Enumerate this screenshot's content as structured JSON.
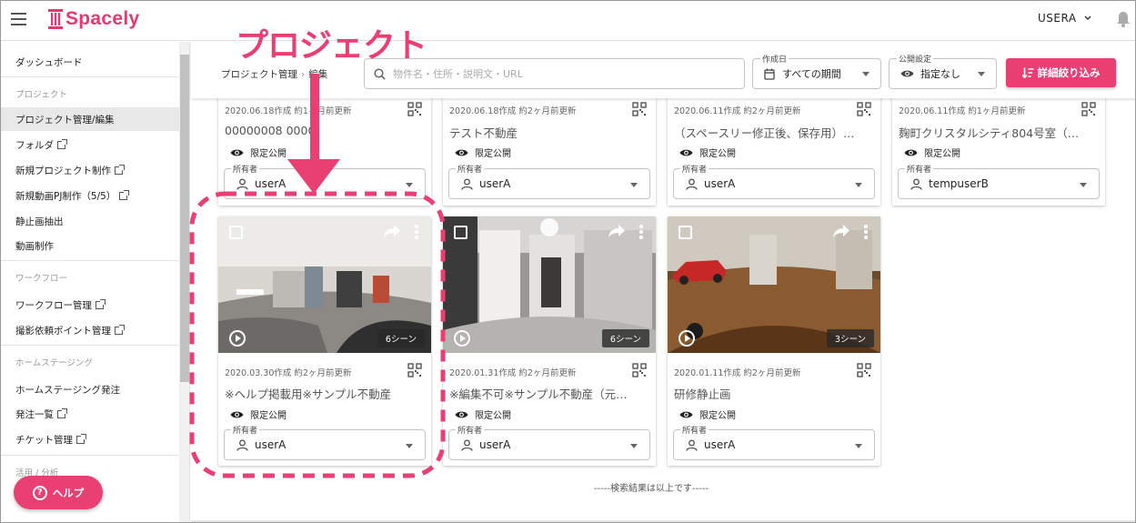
{
  "app": {
    "logo_text": "Spacely",
    "user": "USERA"
  },
  "colors": {
    "brand": "#ea3f73",
    "annotation": "#ea3f73"
  },
  "sidebar": {
    "items": [
      {
        "label": "ダッシュボード",
        "type": "item"
      },
      {
        "label": "プロジェクト",
        "type": "header"
      },
      {
        "label": "プロジェクト管理/編集",
        "type": "item",
        "active": true
      },
      {
        "label": "フォルダ",
        "type": "item",
        "external": true
      },
      {
        "label": "新規プロジェクト制作",
        "type": "item",
        "external": true
      },
      {
        "label": "新規動画PJ制作（5/5）",
        "type": "item",
        "external": true
      },
      {
        "label": "静止画抽出",
        "type": "item"
      },
      {
        "label": "動画制作",
        "type": "item"
      },
      {
        "label": "ワークフロー",
        "type": "header"
      },
      {
        "label": "ワークフロー管理",
        "type": "item",
        "external": true
      },
      {
        "label": "撮影依頼ポイント管理",
        "type": "item",
        "external": true
      },
      {
        "label": "ホームステージング",
        "type": "header"
      },
      {
        "label": "ホームステージング発注",
        "type": "item"
      },
      {
        "label": "発注一覧",
        "type": "item",
        "external": true
      },
      {
        "label": "チケット管理",
        "type": "item",
        "external": true
      },
      {
        "label": "活用 / 分析",
        "type": "header"
      }
    ],
    "help_label": "ヘルプ"
  },
  "filters": {
    "breadcrumb": [
      "プロジェクト管理",
      "編集"
    ],
    "search_placeholder": "物件名・住所・説明文・URL",
    "created": {
      "label": "作成日",
      "value": "すべての期間"
    },
    "visibility": {
      "label": "公開設定",
      "value": "指定なし"
    },
    "advanced_label": "詳細絞り込み"
  },
  "owner_label": "所有者",
  "top_cards": [
    {
      "meta": "2020.06.18作成 約1ヶ月前更新",
      "title": "00000008 0000",
      "visibility": "限定公開",
      "owner": "userA"
    },
    {
      "meta": "2020.06.18作成 約2ヶ月前更新",
      "title": "テスト不動産",
      "visibility": "限定公開",
      "owner": "userA"
    },
    {
      "meta": "2020.06.11作成 約2ヶ月前更新",
      "title": "（スペースリー修正後、保存用）…",
      "visibility": "限定公開",
      "owner": "userA"
    },
    {
      "meta": "2020.06.11作成 約1ヶ月前更新",
      "title": "麹町クリスタルシティ804号室（…",
      "visibility": "限定公開",
      "owner": "tempuserB"
    }
  ],
  "cards": [
    {
      "scenes": "6シーン",
      "meta": "2020.03.30作成 約2ヶ月前更新",
      "title": "※ヘルプ掲載用※サンプル不動産",
      "visibility": "限定公開",
      "owner": "userA"
    },
    {
      "scenes": "6シーン",
      "meta": "2020.01.31作成 約2ヶ月前更新",
      "title": "※編集不可※サンプル不動産（元…",
      "visibility": "限定公開",
      "owner": "userA"
    },
    {
      "scenes": "3シーン",
      "meta": "2020.01.11作成 約2ヶ月前更新",
      "title": "研修静止画",
      "visibility": "限定公開",
      "owner": "userA"
    }
  ],
  "end_message": "-----検索結果は以上です-----",
  "annotation_text": "プロジェクト"
}
